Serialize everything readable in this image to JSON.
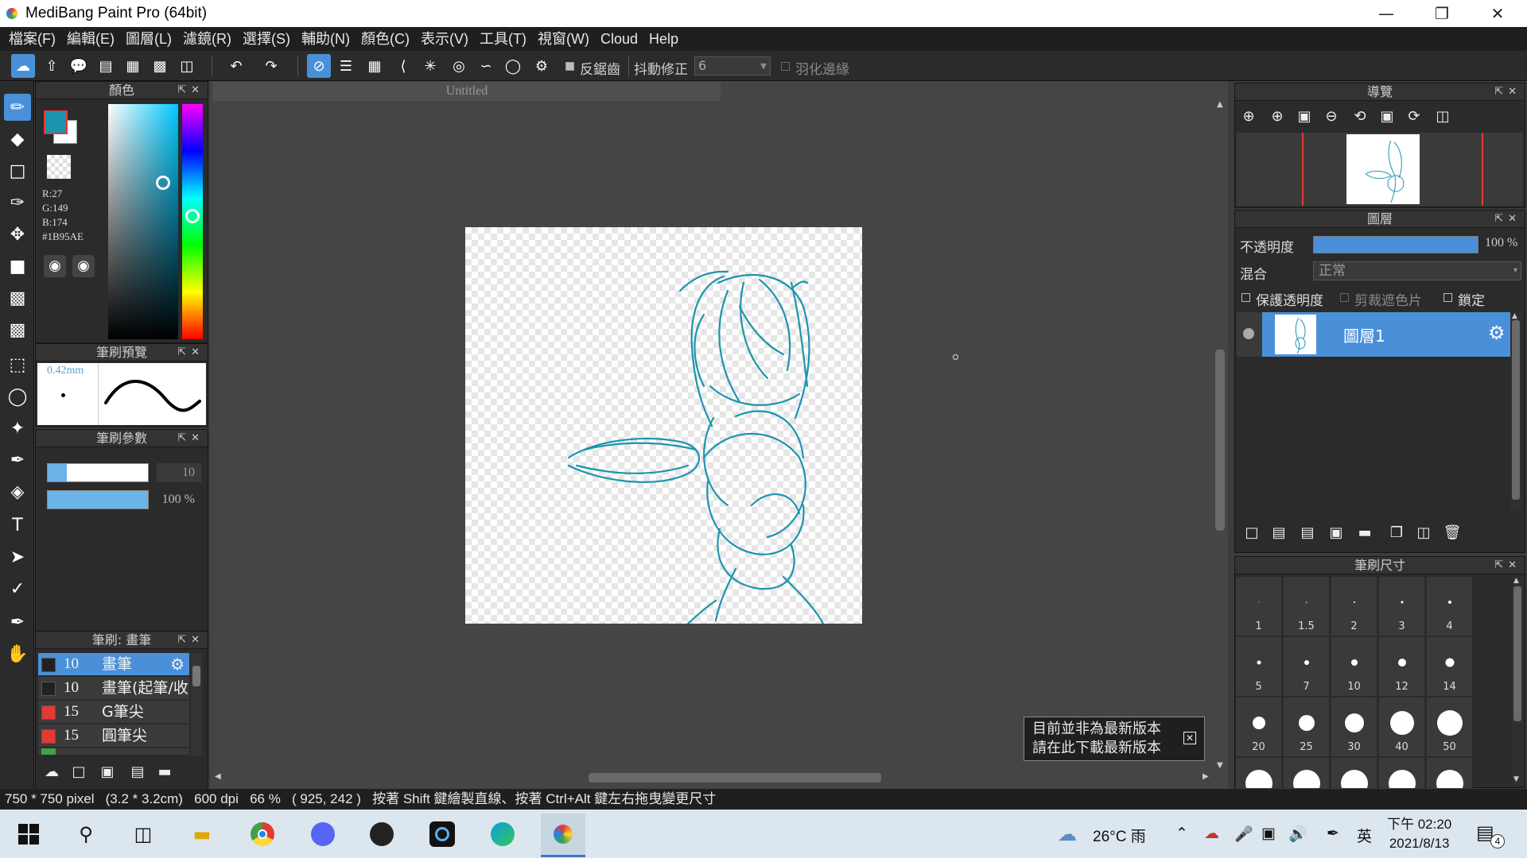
{
  "app": {
    "title": "MediBang Paint Pro (64bit)"
  },
  "menu": [
    "檔案(F)",
    "編輯(E)",
    "圖層(L)",
    "濾鏡(R)",
    "選擇(S)",
    "輔助(N)",
    "顏色(C)",
    "表示(V)",
    "工具(T)",
    "視窗(W)",
    "Cloud",
    "Help"
  ],
  "toolbar": {
    "antialias_label": "反鋸齒",
    "stabilizer_label": "抖動修正",
    "stabilizer_value": "6",
    "feather_label": "羽化邊緣"
  },
  "color_panel": {
    "title": "顏色",
    "r": "R:27",
    "g": "G:149",
    "b": "B:174",
    "hex": "#1B95AE",
    "fg_color": "#1b95ae"
  },
  "brush_preview": {
    "title": "筆刷預覽",
    "size": "0.42mm"
  },
  "brush_params": {
    "title": "筆刷參數",
    "size_value": "10",
    "opacity_value": "100 %"
  },
  "brush_list": {
    "title": "筆刷: 畫筆",
    "items": [
      {
        "num": "10",
        "name": "畫筆",
        "color": "#222222",
        "selected": true
      },
      {
        "num": "10",
        "name": "畫筆(起筆/收",
        "color": "#222222",
        "selected": false
      },
      {
        "num": "15",
        "name": "G筆尖",
        "color": "#e53935",
        "selected": false
      },
      {
        "num": "15",
        "name": "圓筆尖",
        "color": "#e53935",
        "selected": false
      }
    ]
  },
  "document": {
    "tab": "Untitled"
  },
  "navigator": {
    "title": "導覽"
  },
  "layers": {
    "title": "圖層",
    "opacity_label": "不透明度",
    "opacity_value": "100 %",
    "blend_label": "混合",
    "blend_value": "正常",
    "protect_label": "保護透明度",
    "clip_label": "剪裁遮色片",
    "lock_label": "鎖定",
    "layer_name": "圖層1"
  },
  "brush_size": {
    "title": "筆刷尺寸",
    "sizes": [
      "1",
      "1.5",
      "2",
      "3",
      "4",
      "5",
      "7",
      "10",
      "12",
      "14",
      "20",
      "25",
      "30",
      "40",
      "50"
    ]
  },
  "notice": {
    "line1": "目前並非為最新版本",
    "line2": "請在此下載最新版本"
  },
  "status": {
    "text": "750 * 750 pixel   (3.2 * 3.2cm)   600 dpi   66 %   ( 925, 242 )   按著 Shift 鍵繪製直線、按著 Ctrl+Alt 鍵左右拖曳變更尺寸"
  },
  "taskbar": {
    "weather": "26°C 雨",
    "ime": "英",
    "time": "下午 02:20",
    "date": "2021/8/13",
    "notify_count": "4"
  }
}
